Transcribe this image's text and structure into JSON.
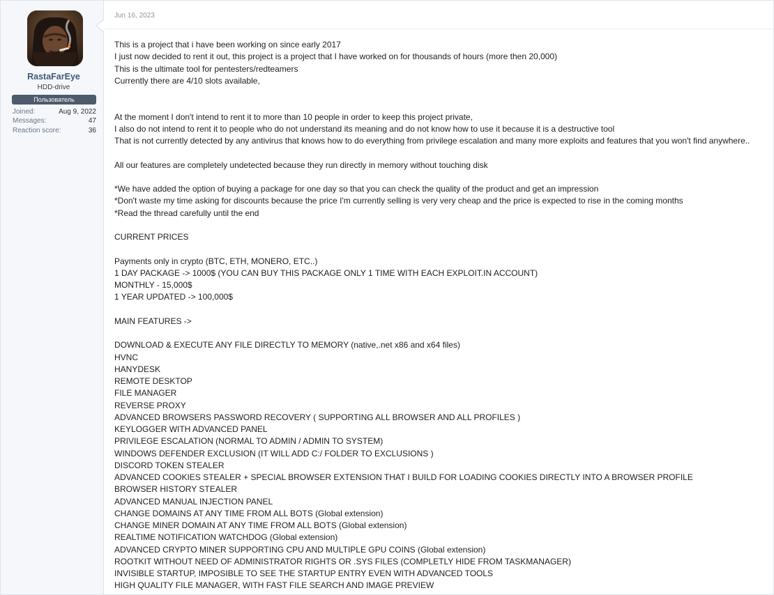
{
  "post": {
    "date": "Jun 16, 2023"
  },
  "user": {
    "name": "RastaFarEye",
    "title": "HDD-drive",
    "role": "Пользователь",
    "stats": [
      {
        "label": "Joined:",
        "value": "Aug 9, 2022"
      },
      {
        "label": "Messages:",
        "value": "47"
      },
      {
        "label": "Reaction score:",
        "value": "36"
      }
    ]
  },
  "content": {
    "lines": [
      "This is a project that i have been working on since early 2017",
      "I just now decided to rent it out, this project is a project that I have worked on for thousands of hours (more then 20,000)",
      "This is the ultimate tool for pentesters/redteamers",
      "Currently there are 4/10 slots available,",
      "",
      "",
      "At the moment I don't intend to rent it to more than 10 people in order to keep this project private,",
      "I also do not intend to rent it to people who do not understand its meaning and do not know how to use it because it is a destructive tool",
      "That is not currently detected by any antivirus that knows how to do everything from privilege escalation and many more exploits and features that you won't find anywhere..",
      "",
      "All our features are completely undetected because they run directly in memory without touching disk",
      "",
      "*We have added the option of buying a package for one day so that you can check the quality of the product and get an impression",
      "*Don't waste my time asking for discounts because the price I'm currently selling is very very cheap and the price is expected to rise in the coming months",
      "*Read the thread carefully until the end",
      "",
      "CURRENT PRICES",
      "",
      "Payments only in crypto (BTC, ETH, MONERO, ETC..)",
      "1 DAY PACKAGE -> 1000$ (YOU CAN BUY THIS PACKAGE ONLY 1 TIME WITH EACH EXPLOIT.IN ACCOUNT)",
      "MONTHLY - 15,000$",
      "1 YEAR UPDATED -> 100,000$",
      "",
      "MAIN FEATURES ->",
      "",
      "DOWNLOAD & EXECUTE ANY FILE DIRECTLY TO MEMORY (native,.net x86 and x64 files)",
      "HVNC",
      "HANYDESK",
      "REMOTE DESKTOP",
      "FILE MANAGER",
      "REVERSE PROXY",
      "ADVANCED BROWSERS PASSWORD RECOVERY ( SUPPORTING ALL BROWSER AND ALL PROFILES )",
      "KEYLOGGER WITH ADVANCED PANEL",
      "PRIVILEGE ESCALATION (NORMAL TO ADMIN / ADMIN TO SYSTEM)",
      "WINDOWS DEFENDER EXCLUSION (IT WILL ADD C:/ FOLDER TO EXCLUSIONS )",
      "DISCORD TOKEN STEALER",
      "ADVANCED COOKIES STEALER + SPECIAL BROWSER EXTENSION THAT I BUILD FOR LOADING COOKIES DIRECTLY INTO A BROWSER PROFILE",
      "BROWSER HISTORY STEALER",
      "ADVANCED MANUAL INJECTION PANEL",
      "CHANGE DOMAINS AT ANY TIME FROM ALL BOTS (Global extension)",
      "CHANGE MINER DOMAIN AT ANY TIME FROM ALL BOTS (Global extension)",
      "REALTIME NOTIFICATION WATCHDOG (Global extension)",
      "ADVANCED CRYPTO MINER SUPPORTING CPU AND MULTIPLE GPU COINS (Global extension)",
      "ROOTKIT WITHOUT NEED OF ADMINISTRATOR RIGHTS OR .SYS FILES (COMPLETLY HIDE FROM TASKMANAGER)",
      "INVISIBLE STARTUP, IMPOSIBLE TO SEE THE STARTUP ENTRY EVEN WITH ADVANCED TOOLS",
      "HIGH QUALITY FILE MANAGER, WITH FAST FILE SEARCH AND IMAGE PREVIEW"
    ]
  }
}
